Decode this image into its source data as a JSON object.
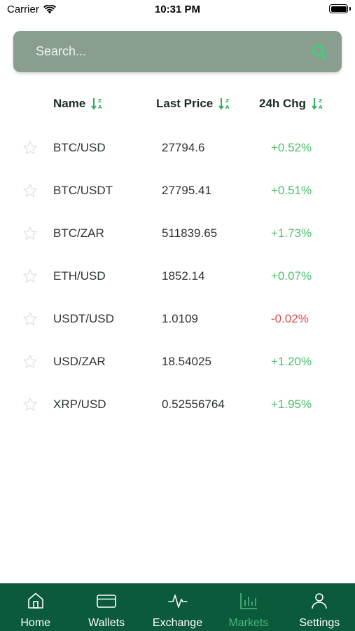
{
  "status_bar": {
    "carrier": "Carrier",
    "time": "10:31 PM"
  },
  "search": {
    "placeholder": "Search..."
  },
  "table": {
    "headers": {
      "name": "Name",
      "price": "Last Price",
      "change": "24h Chg"
    },
    "rows": [
      {
        "pair": "BTC/USD",
        "price": "27794.6",
        "change": "+0.52%",
        "direction": "up"
      },
      {
        "pair": "BTC/USDT",
        "price": "27795.41",
        "change": "+0.51%",
        "direction": "up"
      },
      {
        "pair": "BTC/ZAR",
        "price": "511839.65",
        "change": "+1.73%",
        "direction": "up"
      },
      {
        "pair": "ETH/USD",
        "price": "1852.14",
        "change": "+0.07%",
        "direction": "up"
      },
      {
        "pair": "USDT/USD",
        "price": "1.0109",
        "change": "-0.02%",
        "direction": "down"
      },
      {
        "pair": "USD/ZAR",
        "price": "18.54025",
        "change": "+1.20%",
        "direction": "up"
      },
      {
        "pair": "XRP/USD",
        "price": "0.52556764",
        "change": "+1.95%",
        "direction": "up"
      }
    ]
  },
  "tab_bar": {
    "tabs": [
      {
        "label": "Home",
        "icon": "home-icon"
      },
      {
        "label": "Wallets",
        "icon": "wallet-icon"
      },
      {
        "label": "Exchange",
        "icon": "pulse-icon"
      },
      {
        "label": "Markets",
        "icon": "bar-chart-icon",
        "active": true
      },
      {
        "label": "Settings",
        "icon": "user-icon"
      }
    ]
  },
  "colors": {
    "accent_green": "#4cc06a",
    "negative_red": "#e0494f",
    "tab_bar_bg": "#0c5a3c",
    "search_bg": "#8a9e90",
    "active_tab": "#4cb87a"
  }
}
